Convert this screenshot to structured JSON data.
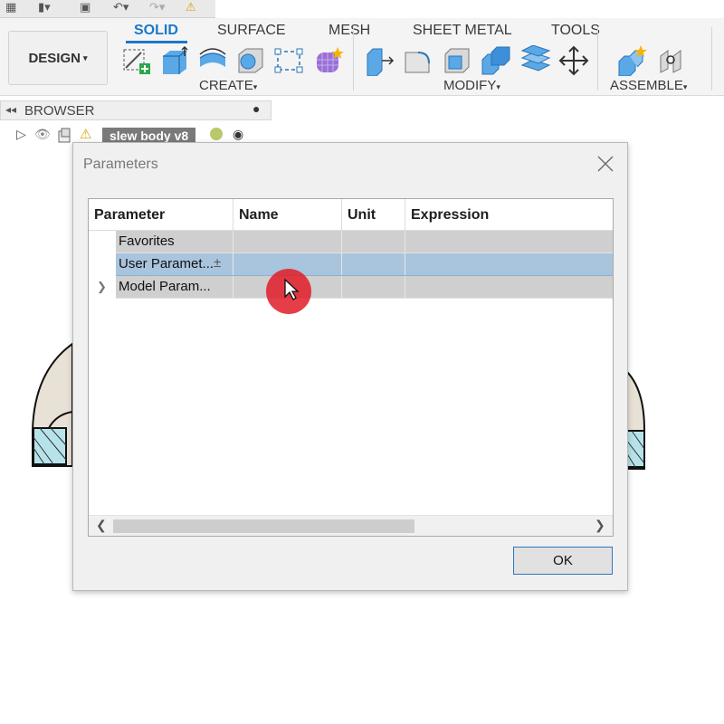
{
  "quick_access": {
    "icons": [
      "grid-icon",
      "file-icon",
      "save-icon",
      "undo-icon",
      "redo-icon",
      "warning-icon"
    ]
  },
  "toolbar": {
    "workspace_label": "DESIGN",
    "tabs": [
      "SOLID",
      "SURFACE",
      "MESH",
      "SHEET METAL",
      "TOOLS"
    ],
    "active_tab": "SOLID",
    "groups": {
      "create": "CREATE",
      "modify": "MODIFY",
      "assemble": "ASSEMBLE"
    }
  },
  "browser": {
    "title": "BROWSER",
    "document_name": "slew body v8"
  },
  "dialog": {
    "title": "Parameters",
    "columns": [
      "Parameter",
      "Name",
      "Unit",
      "Expression"
    ],
    "rows": [
      {
        "label": "Favorites",
        "expandable": false,
        "selected": false
      },
      {
        "label": "User Paramet...",
        "expandable": false,
        "selected": true
      },
      {
        "label": "Model Param...",
        "expandable": true,
        "selected": false
      }
    ],
    "ok_label": "OK"
  },
  "colors": {
    "accent": "#1a78c8",
    "selected_row": "#a9c4dd",
    "row_bg": "#cfcfcf",
    "cursor_marker": "#e21c28"
  }
}
